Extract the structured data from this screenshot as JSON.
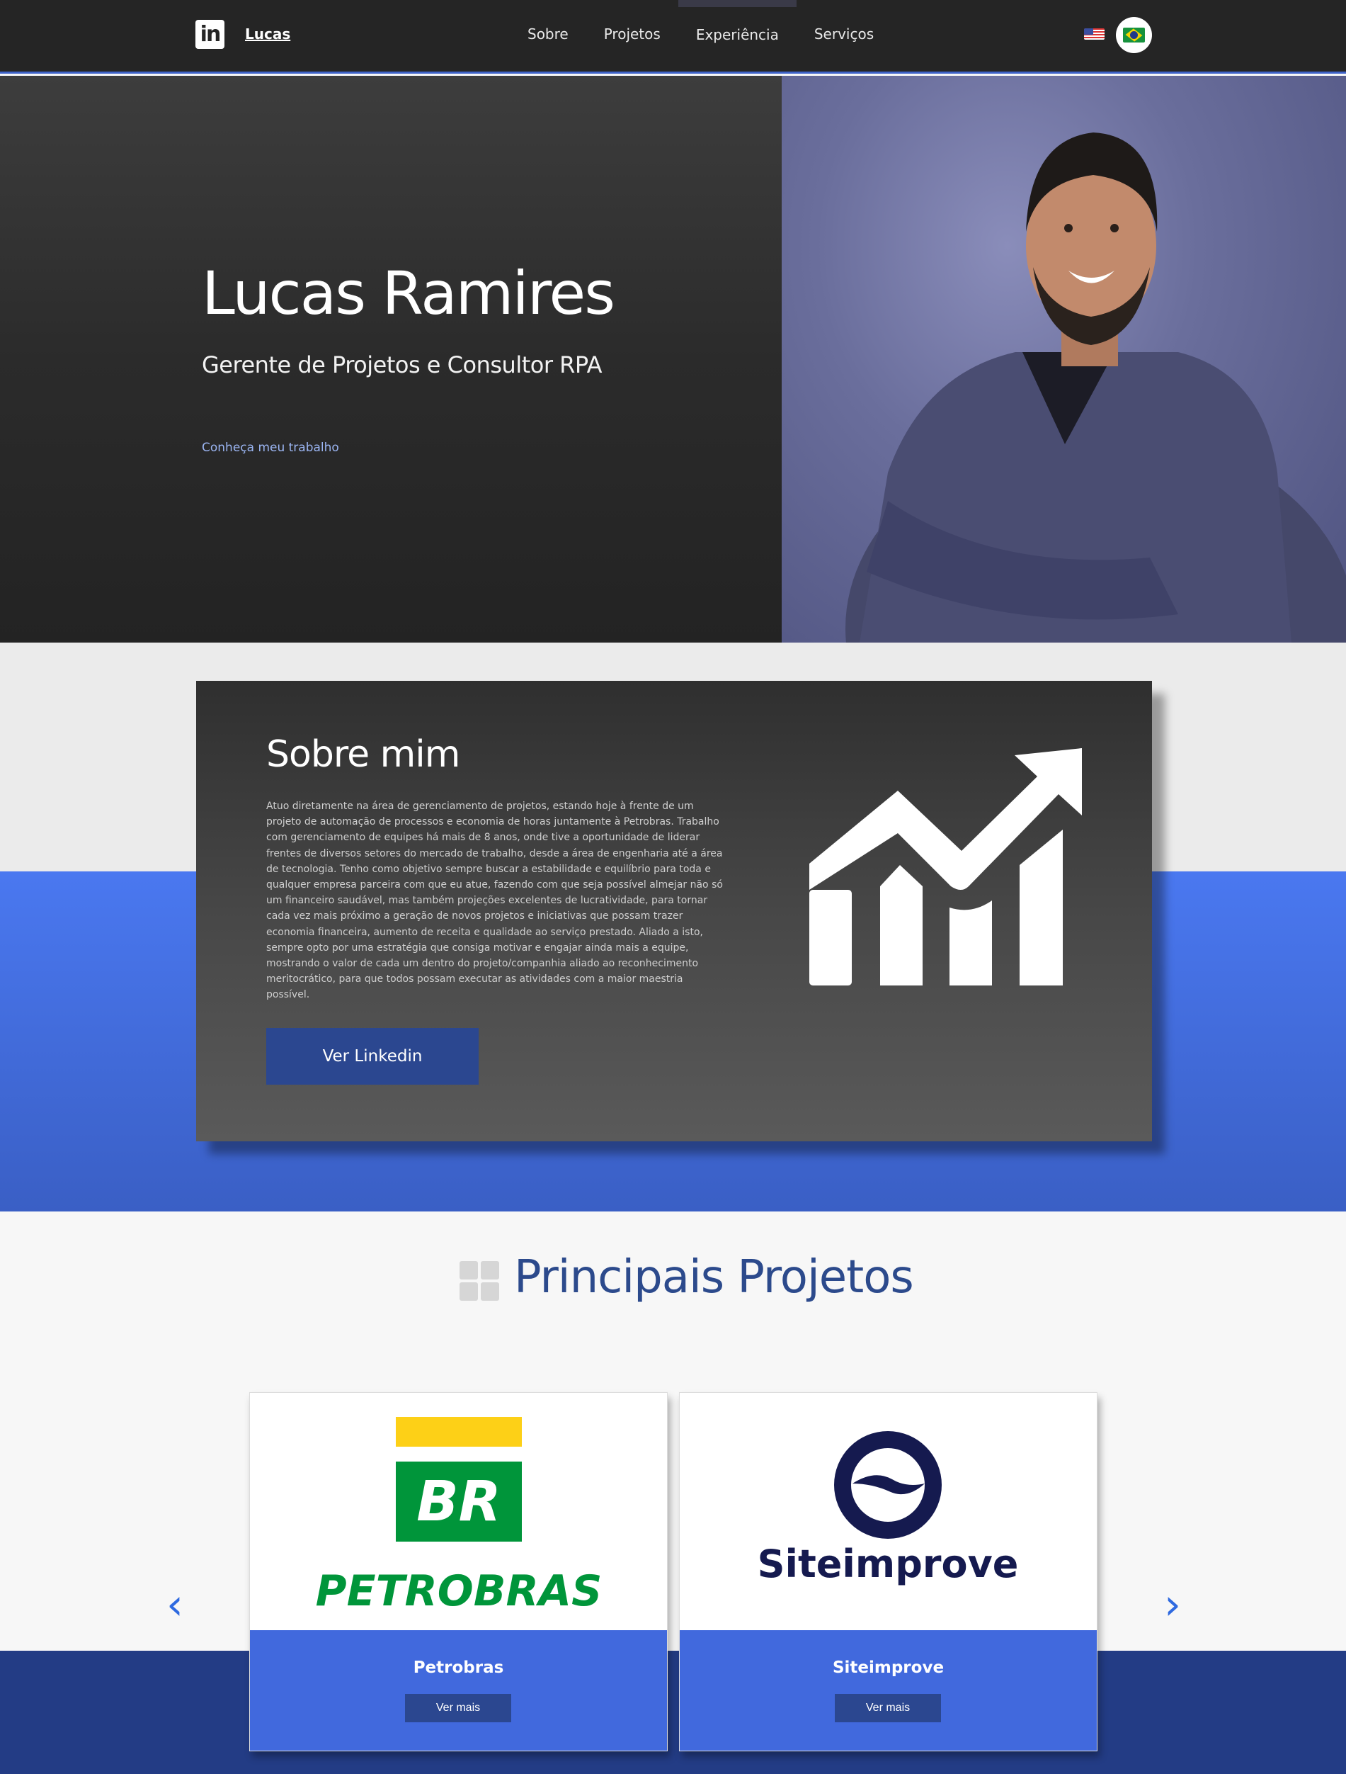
{
  "nav": {
    "brand": "Lucas",
    "logo_text": "in",
    "items": [
      {
        "label": "Sobre"
      },
      {
        "label": "Projetos"
      },
      {
        "label": "Experiência"
      },
      {
        "label": "Serviços"
      }
    ],
    "icons": [
      "linkedin-icon",
      "us-flag-icon",
      "brazil-flag-icon"
    ]
  },
  "hero": {
    "name": "Lucas Ramires",
    "title": "Gerente de Projetos e Consultor RPA",
    "cta": "Conheça meu trabalho"
  },
  "about": {
    "title": "Sobre mim",
    "text": "Atuo diretamente na área de gerenciamento de projetos, estando hoje à frente de um projeto de automação de processos e economia de horas juntamente à Petrobras. Trabalho com gerenciamento de equipes há mais de 8 anos, onde tive a oportunidade de liderar frentes de diversos setores do mercado de trabalho, desde a área de engenharia até a área de tecnologia. Tenho como objetivo sempre buscar a estabilidade e equilíbrio para toda e qualquer empresa parceira com que eu atue, fazendo com que seja possível almejar não só um financeiro saudável, mas também projeções excelentes de lucratividade, para tornar cada vez mais próximo a geração de novos projetos e iniciativas que possam trazer economia financeira, aumento de receita e qualidade ao serviço prestado. Aliado a isto, sempre opto por uma estratégia que consiga motivar e engajar ainda mais a equipe, mostrando o valor de cada um dentro do projeto/companhia aliado ao reconhecimento meritocrático, para que todos possam executar as atividades com a maior maestria possível.",
    "button": "Ver Linkedin",
    "icon": "growth-chart-icon"
  },
  "projects": {
    "title": "Principais Projetos",
    "icon": "grid-icon",
    "cards": [
      {
        "name": "Petrobras",
        "button": "Ver mais",
        "logo_top": "BR",
        "logo_bottom": "PETROBRAS"
      },
      {
        "name": "Siteimprove",
        "button": "Ver mais",
        "logo_text": "Siteimprove"
      }
    ],
    "prev_icon": "chevron-left-icon",
    "next_icon": "chevron-right-icon",
    "colors": {
      "primary": "#4169dd",
      "dark": "#2b4790",
      "petrobras_green": "#00953a",
      "petrobras_yellow": "#fdd017",
      "siteimprove_navy": "#151a4f"
    }
  }
}
